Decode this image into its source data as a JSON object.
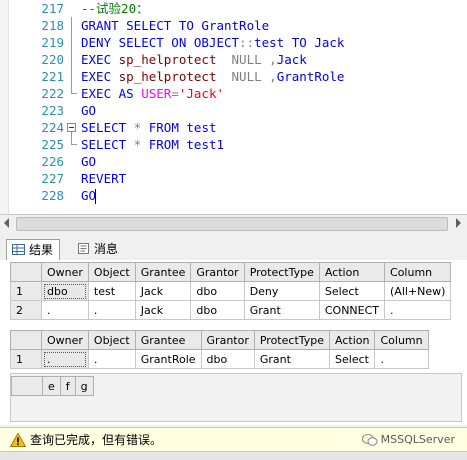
{
  "editor": {
    "lines": [
      {
        "num": "217",
        "tokens": [
          {
            "t": "--试验20：",
            "c": "cm"
          }
        ]
      },
      {
        "num": "218",
        "tokens": [
          {
            "t": "GRANT SELECT TO ",
            "c": "kw"
          },
          {
            "t": "GrantRole",
            "c": "kw"
          }
        ]
      },
      {
        "num": "219",
        "tokens": [
          {
            "t": "DENY SELECT ON OBJECT",
            "c": "kw"
          },
          {
            "t": "::",
            "c": "gy"
          },
          {
            "t": "test ",
            "c": "kw"
          },
          {
            "t": "TO ",
            "c": "kw"
          },
          {
            "t": "Jack",
            "c": "kw"
          }
        ]
      },
      {
        "num": "220",
        "tokens": [
          {
            "t": "EXEC ",
            "c": "kw"
          },
          {
            "t": "sp_helprotect  ",
            "c": "sp"
          },
          {
            "t": "NULL ",
            "c": "gy"
          },
          {
            "t": ",",
            "c": "gy"
          },
          {
            "t": "Jack",
            "c": "kw"
          }
        ]
      },
      {
        "num": "221",
        "tokens": [
          {
            "t": "EXEC ",
            "c": "kw"
          },
          {
            "t": "sp_helprotect  ",
            "c": "sp"
          },
          {
            "t": "NULL ",
            "c": "gy"
          },
          {
            "t": ",",
            "c": "gy"
          },
          {
            "t": "GrantRole",
            "c": "kw"
          }
        ]
      },
      {
        "num": "222",
        "tokens": [
          {
            "t": "EXEC AS ",
            "c": "kw"
          },
          {
            "t": "USER",
            "c": "pk"
          },
          {
            "t": "=",
            "c": "gy"
          },
          {
            "t": "'Jack'",
            "c": "str"
          }
        ]
      },
      {
        "num": "223",
        "tokens": [
          {
            "t": "GO",
            "c": "kw"
          }
        ]
      },
      {
        "num": "224",
        "tokens": [
          {
            "t": "SELECT ",
            "c": "kw"
          },
          {
            "t": "* ",
            "c": "gy"
          },
          {
            "t": "FROM ",
            "c": "kw"
          },
          {
            "t": "test",
            "c": "kw"
          }
        ]
      },
      {
        "num": "225",
        "tokens": [
          {
            "t": "SELECT ",
            "c": "kw"
          },
          {
            "t": "* ",
            "c": "gy"
          },
          {
            "t": "FROM ",
            "c": "kw"
          },
          {
            "t": "test1",
            "c": "kw"
          }
        ]
      },
      {
        "num": "226",
        "tokens": [
          {
            "t": "GO",
            "c": "kw"
          }
        ]
      },
      {
        "num": "227",
        "tokens": [
          {
            "t": "REVERT",
            "c": "kw"
          }
        ]
      },
      {
        "num": "228",
        "tokens": [
          {
            "t": "GO",
            "c": "kw"
          }
        ]
      }
    ]
  },
  "tabs": {
    "results_label": "结果",
    "messages_label": "消息"
  },
  "grid1": {
    "columns": [
      "Owner",
      "Object",
      "Grantee",
      "Grantor",
      "ProtectType",
      "Action",
      "Column"
    ],
    "rows": [
      {
        "n": "1",
        "cells": [
          "dbo",
          "test",
          "Jack",
          "dbo",
          "Deny",
          "Select",
          "(All+New)"
        ]
      },
      {
        "n": "2",
        "cells": [
          ".",
          ".",
          "Jack",
          "dbo",
          "Grant",
          "CONNECT",
          "."
        ]
      }
    ]
  },
  "grid2": {
    "columns": [
      "Owner",
      "Object",
      "Grantee",
      "Grantor",
      "ProtectType",
      "Action",
      "Column"
    ],
    "rows": [
      {
        "n": "1",
        "cells": [
          ".",
          ".",
          "GrantRole",
          "dbo",
          "Grant",
          "Select",
          "."
        ]
      }
    ]
  },
  "grid3": {
    "columns": [
      "e",
      "f",
      "g"
    ]
  },
  "status": {
    "message": "查询已完成，但有错误。",
    "brand": "MSSQLServer"
  },
  "colors": {
    "keyword": "#0000ff",
    "comment": "#008000",
    "proc": "#800000",
    "operator": "#808080",
    "string": "#ff0000",
    "system": "#ff00ff",
    "line_number": "#2b91af",
    "status_bg": "#ffffe1"
  }
}
